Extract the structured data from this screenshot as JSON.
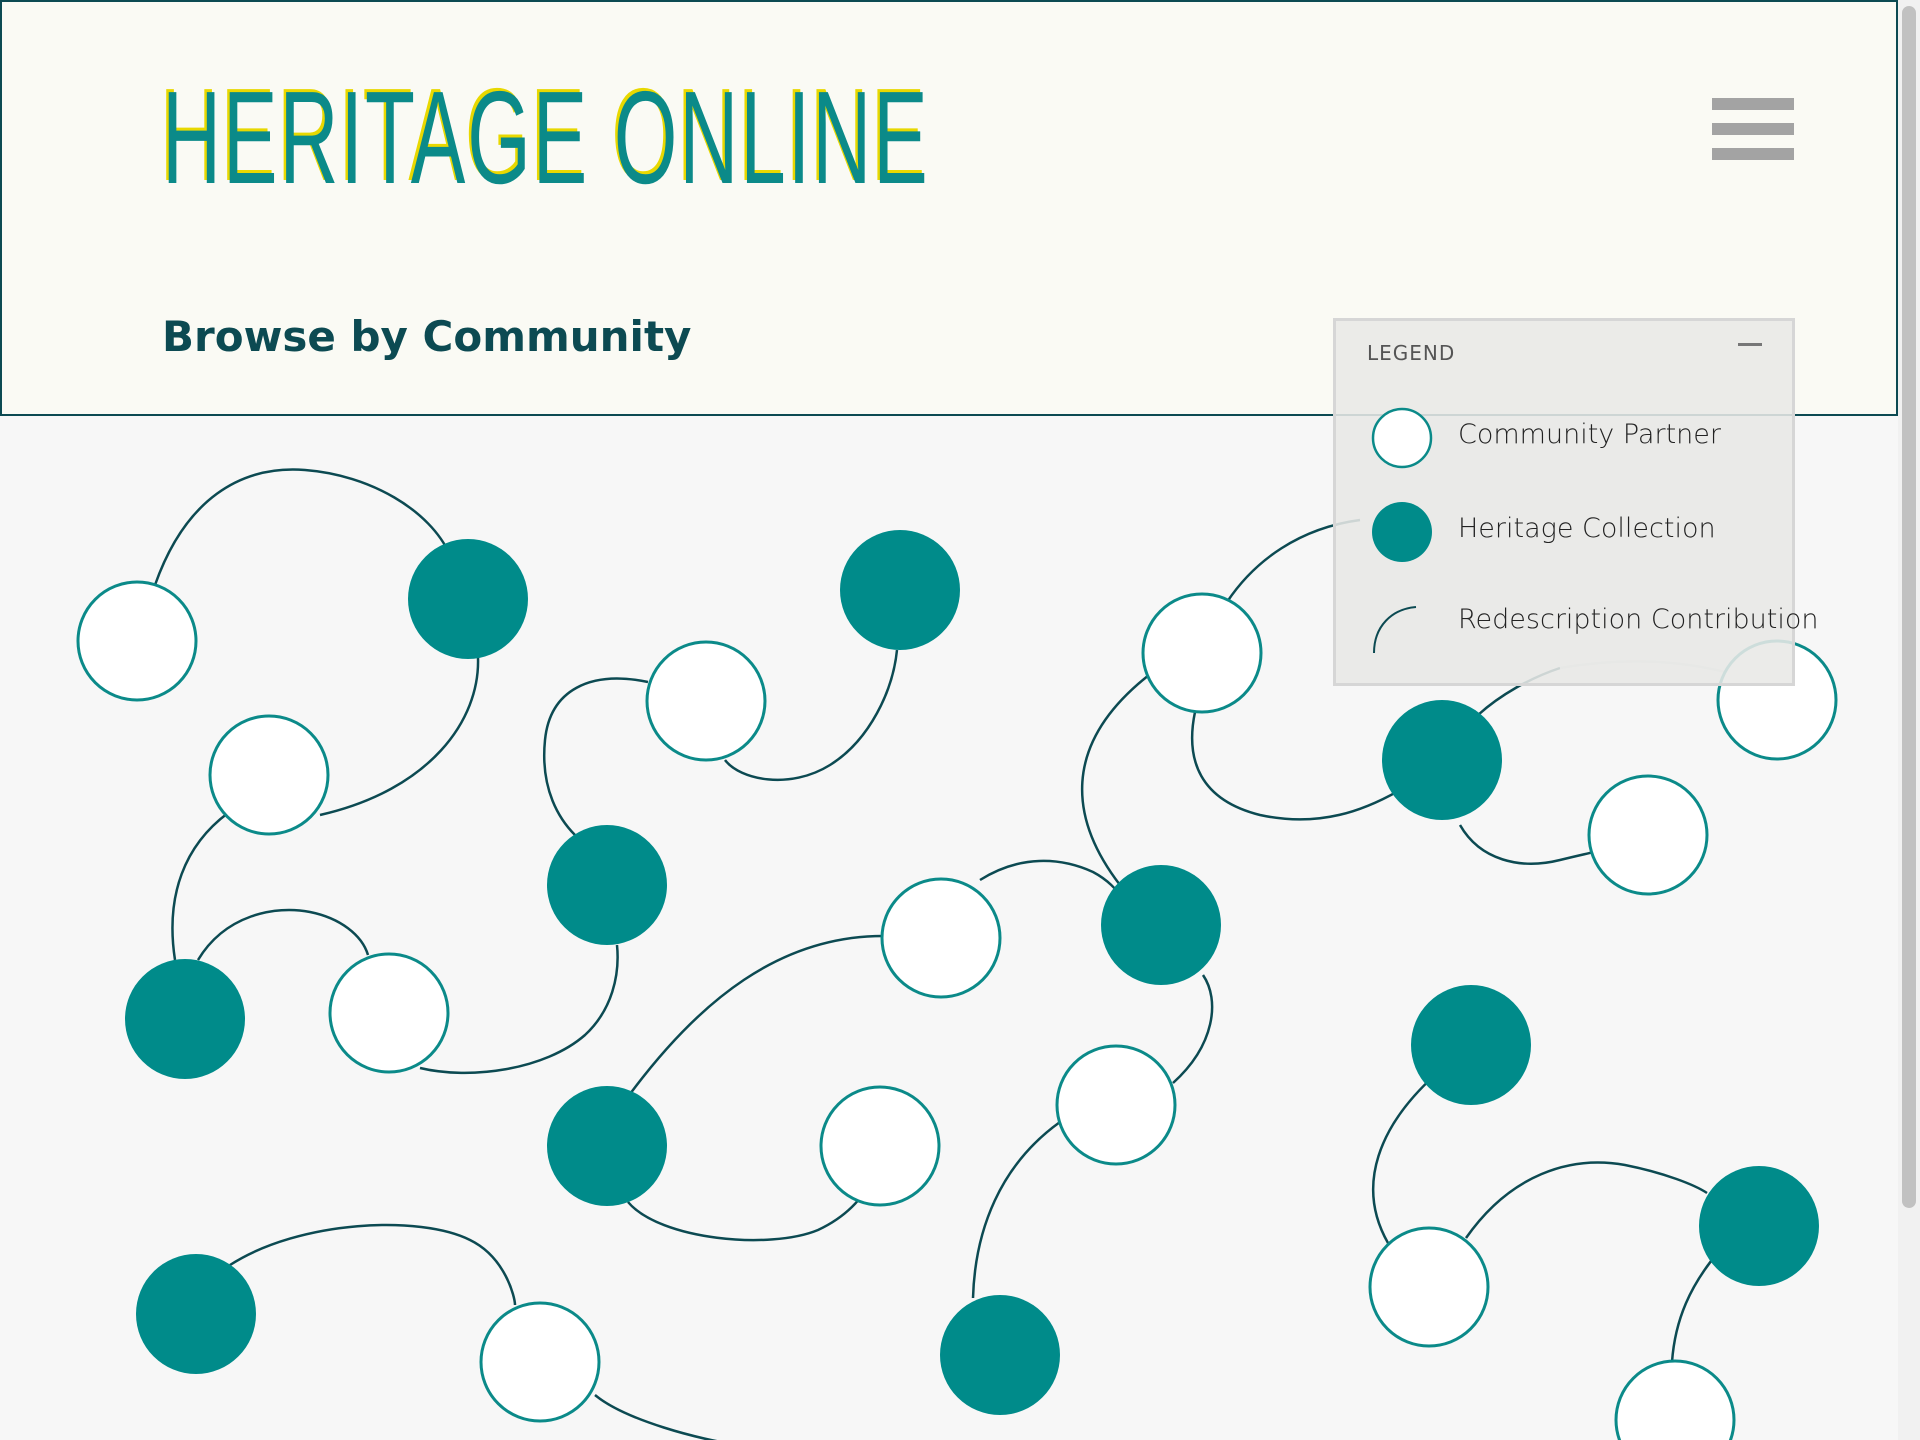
{
  "header": {
    "logo": "HERITAGE ONLINE",
    "title": "Browse by Community",
    "menu_icon": "hamburger-menu-icon"
  },
  "legend": {
    "title": "LEGEND",
    "collapse_icon": "minus-icon",
    "items": [
      {
        "label": "Community Partner",
        "symbol": "white-circle"
      },
      {
        "label": "Heritage Collection",
        "symbol": "teal-circle"
      },
      {
        "label": "Redescription Contribution",
        "symbol": "curved-line"
      }
    ]
  },
  "colors": {
    "teal": "#008b8a",
    "dark_teal": "#0c4a52",
    "logo_yellow": "#e8d800",
    "header_bg": "#fafaf4",
    "canvas_bg": "#f7f7f7"
  }
}
